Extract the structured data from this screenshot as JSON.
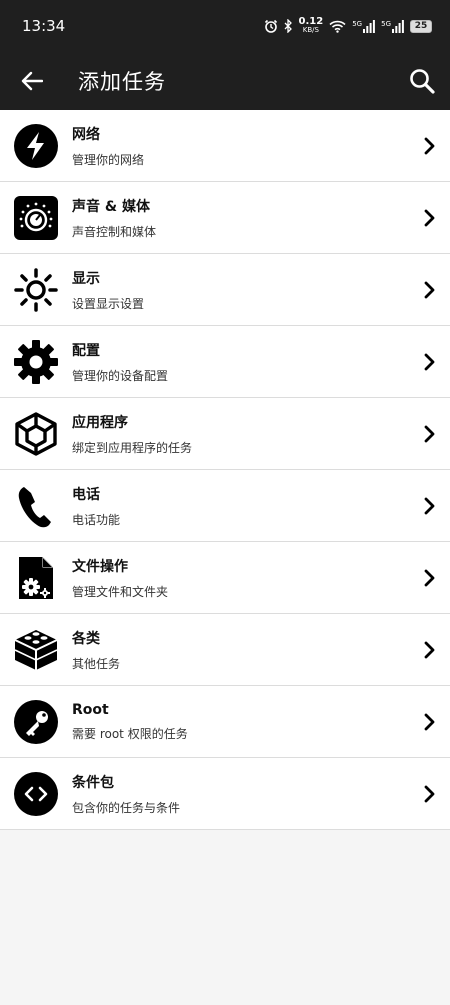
{
  "status": {
    "time": "13:34",
    "net_speed": "0.12",
    "net_unit": "KB/S",
    "sig1_label": "5G",
    "sig2_label": "5G",
    "battery": "25"
  },
  "toolbar": {
    "title": "添加任务"
  },
  "items": [
    {
      "title": "网络",
      "subtitle": "管理你的网络",
      "icon": "lightning-icon"
    },
    {
      "title": "声音 & 媒体",
      "subtitle": "声音控制和媒体",
      "icon": "volume-knob-icon"
    },
    {
      "title": "显示",
      "subtitle": "设置显示设置",
      "icon": "sun-icon"
    },
    {
      "title": "配置",
      "subtitle": "管理你的设备配置",
      "icon": "gear-icon"
    },
    {
      "title": "应用程序",
      "subtitle": "绑定到应用程序的任务",
      "icon": "app-cube-icon"
    },
    {
      "title": "电话",
      "subtitle": "电话功能",
      "icon": "phone-icon"
    },
    {
      "title": "文件操作",
      "subtitle": "管理文件和文件夹",
      "icon": "file-gear-icon"
    },
    {
      "title": "各类",
      "subtitle": "其他任务",
      "icon": "brick-icon"
    },
    {
      "title": "Root",
      "subtitle": "需要 root 权限的任务",
      "icon": "key-icon"
    },
    {
      "title": "条件包",
      "subtitle": "包含你的任务与条件",
      "icon": "code-icon"
    }
  ]
}
